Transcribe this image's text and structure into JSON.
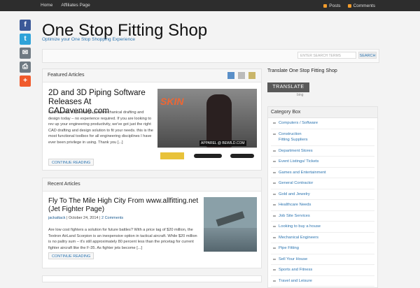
{
  "topbar": {
    "nav": [
      "Home",
      "Affiliates Page"
    ],
    "posts": "Posts",
    "comments": "Comments"
  },
  "share": [
    {
      "icon": "facebook-icon",
      "glyph": "f",
      "color": "#3b5998"
    },
    {
      "icon": "twitter-icon",
      "glyph": "t",
      "color": "#2fa3d9"
    },
    {
      "icon": "email-icon",
      "glyph": "✉",
      "color": "#6f7a83"
    },
    {
      "icon": "print-icon",
      "glyph": "⎙",
      "color": "#6f7a83"
    },
    {
      "icon": "plus-icon",
      "glyph": "+",
      "color": "#f05a2b"
    }
  ],
  "site": {
    "title": "One Stop Fitting Shop",
    "tagline": "Optimize your One Stop Shopping Experience"
  },
  "search": {
    "placeholder": "ENTER SEARCH TERMS",
    "button": "SEARCH"
  },
  "featured": {
    "header": "Featured Articles",
    "title": "2D and 3D Piping Software Releases At CADavenue.com",
    "text": "CADavenue Turbocharge your mechanical drafting and design today – no experience required. If you are looking to rev up your engineering productivity, we've got just the right CAD drafting and design solution to fit your needs. this is the most functional toolbox for all engineering disciplines I have ever been privilege in using. Thank you [...]",
    "button": "CONTINUE READING",
    "image_text": {
      "skin": "SKIN",
      "apparel": "APPAREL @ BEWILD.COM"
    }
  },
  "recent": {
    "header": "Recent Articles",
    "title": "Fly To The Mile High City From www.allfitting.net (Jet Fighter Page)",
    "author": "jackattack",
    "date": "October 24, 2014",
    "comments": "2 Comments",
    "text": "Are low cost fighters a solution for future battles? With a price tag of $20 million, the Textron AirLand Scorpion is an inexpensive option in tactical aircraft. While $20 million is no paltry sum – it's still approximately 80 percent less than the pricetag for current fighter aircraft like the F-35. As fighter jets become [...]",
    "button": "CONTINUE READING"
  },
  "sidebar": {
    "translate_title": "Translate One Stop Fitting Shop",
    "translate_button": "TRANSLATE",
    "bing": "bing",
    "category_header": "Category Box",
    "categories": [
      "Computers / Software",
      "Construction\nFitting Suppliers",
      "Department Stores",
      "Event Listings/ Tickets",
      "Games and Entertainment",
      "General Contractor",
      "Gold and Jewelry",
      "Healthcare Needs",
      "Job Site Services",
      "Looking to buy a house",
      "Mechanical Engineers",
      "Pipe Fitting",
      "Sell Your House",
      "Sports and Fitness",
      "Travel and Leisure"
    ]
  }
}
